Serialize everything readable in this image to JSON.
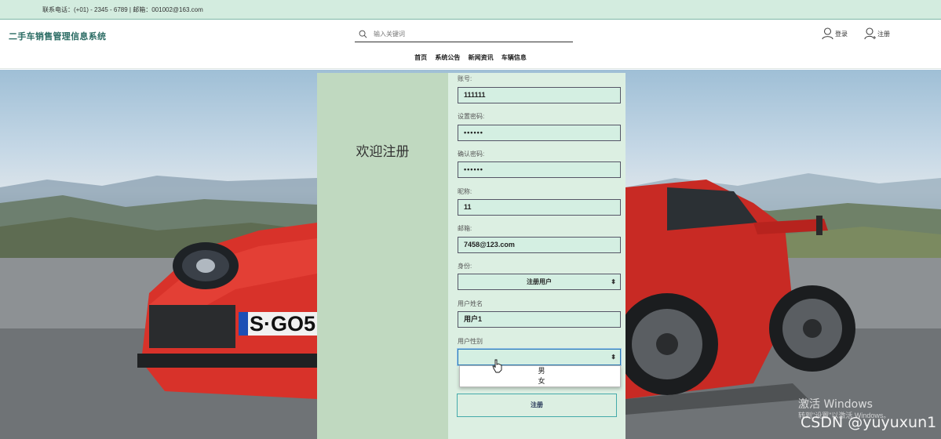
{
  "topbar": {
    "contact": "联系电话：(+01) - 2345 - 6789 | 邮箱：001002@163.com"
  },
  "header": {
    "logo": "二手车销售管理信息系统",
    "search_placeholder": "输入关键词",
    "login": "登录",
    "register": "注册"
  },
  "nav": [
    "首页",
    "系统公告",
    "新闻资讯",
    "车辆信息"
  ],
  "form": {
    "welcome": "欢迎注册",
    "account_label": "账号:",
    "account_value": "111111",
    "password_label": "设置密码:",
    "password_value": "••••••",
    "confirm_label": "确认密码:",
    "confirm_value": "••••••",
    "nickname_label": "昵称:",
    "nickname_value": "11",
    "email_label": "邮箱:",
    "email_value": "7458@123.com",
    "role_label": "身份:",
    "role_value": "注册用户",
    "realname_label": "用户姓名",
    "realname_value": "用户1",
    "gender_label": "用户性别",
    "gender_value": "",
    "gender_options": [
      "男",
      "女"
    ],
    "submit": "注册"
  },
  "overlay": {
    "activate_title": "激活 Windows",
    "activate_sub": "转到\"设置\"以激活 Windows。",
    "csdn": "CSDN @yuyuxun1"
  },
  "colors": {
    "accent": "#2a6b63",
    "topbar_bg": "#d3ecdf",
    "panel_left": "#c0d9c0",
    "panel_right": "#dcefe2",
    "car_red": "#d8322a"
  }
}
